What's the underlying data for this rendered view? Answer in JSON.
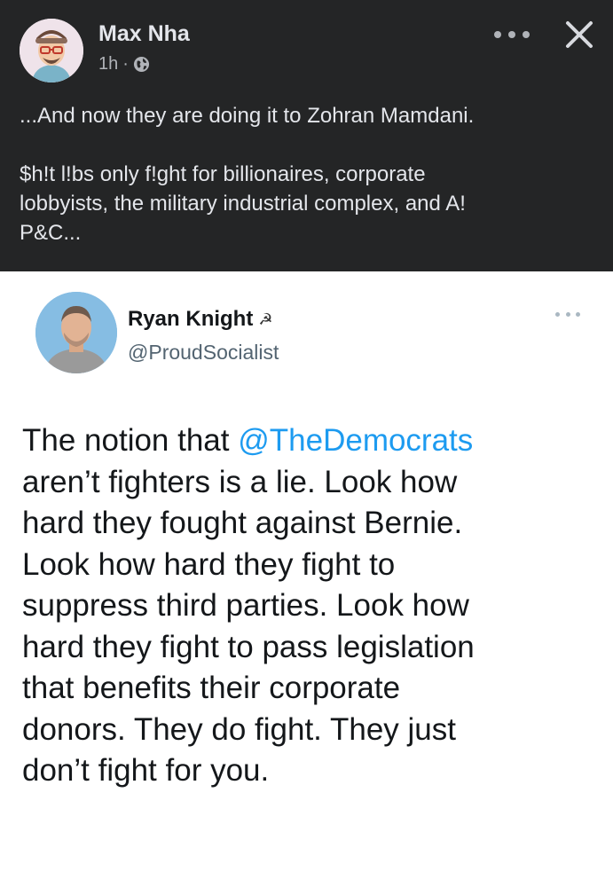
{
  "fb_post": {
    "author": "Max Nha",
    "time": "1h",
    "separator": "·",
    "icons": {
      "avatar": "cartoon-avatar-icon",
      "visibility": "globe-icon",
      "more": "more-options-icon",
      "close": "close-icon"
    },
    "text_line_1": "...And now they are doing it to Zohran Mamdani.",
    "text_line_2": "$h!t l!bs only f!ght for billionaires, corporate",
    "text_line_3": "lobbyists, the military industrial complex, and A!",
    "text_line_4": "P&C..."
  },
  "tweet": {
    "name": "Ryan Knight",
    "flag": "☭",
    "handle": "@ProudSocialist",
    "lines": [
      {
        "before": "The notion that ",
        "mention": "@TheDemocrats",
        "after": ""
      },
      {
        "text": "aren’t fighters is a lie. Look how"
      },
      {
        "text": "hard they fought against Bernie."
      },
      {
        "text": "Look how hard they fight to"
      },
      {
        "text": "suppress third parties. Look how"
      },
      {
        "text": "hard they fight to pass legislation"
      },
      {
        "text": "that benefits their corporate"
      },
      {
        "text": "donors. They do fight. They just"
      },
      {
        "text": "don’t fight for you."
      }
    ]
  },
  "colors": {
    "fb_bg": "#242526",
    "fb_text": "#e4e6eb",
    "fb_muted": "#b0b3b8",
    "tweet_text": "#14171a",
    "mention": "#1d9bf0",
    "handle": "#536471"
  }
}
